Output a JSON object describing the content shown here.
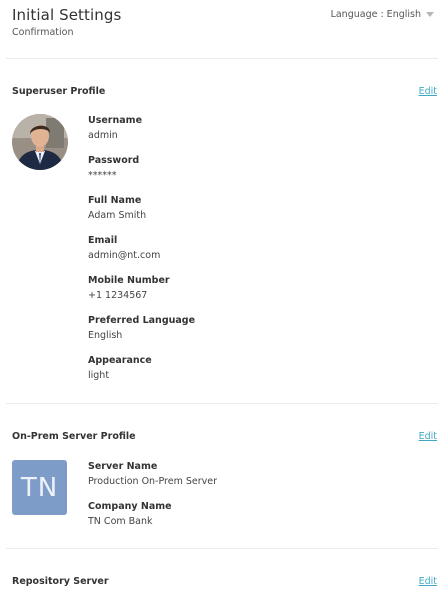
{
  "header": {
    "title": "Initial Settings",
    "subtitle": "Confirmation",
    "language_label": "Language : English"
  },
  "superuser": {
    "section_title": "Superuser Profile",
    "edit_label": "Edit",
    "fields": [
      {
        "label": "Username",
        "value": "admin"
      },
      {
        "label": "Password",
        "value": "******"
      },
      {
        "label": "Full Name",
        "value": "Adam Smith"
      },
      {
        "label": "Email",
        "value": "admin@nt.com"
      },
      {
        "label": "Mobile Number",
        "value": "+1 1234567"
      },
      {
        "label": "Preferred Language",
        "value": "English"
      },
      {
        "label": "Appearance",
        "value": "light"
      }
    ]
  },
  "onprem": {
    "section_title": "On-Prem Server Profile",
    "edit_label": "Edit",
    "avatar_initials": "TN",
    "fields": [
      {
        "label": "Server Name",
        "value": "Production On-Prem Server"
      },
      {
        "label": "Company Name",
        "value": "TN Com Bank"
      }
    ]
  },
  "repository": {
    "section_title": "Repository Server",
    "edit_label": "Edit"
  },
  "icons": {
    "language_dropdown": "chevron-down-icon",
    "profile_photo": "user-avatar"
  },
  "colors": {
    "link": "#3fa9c5",
    "tn_avatar_bg": "#7e9cc8"
  }
}
